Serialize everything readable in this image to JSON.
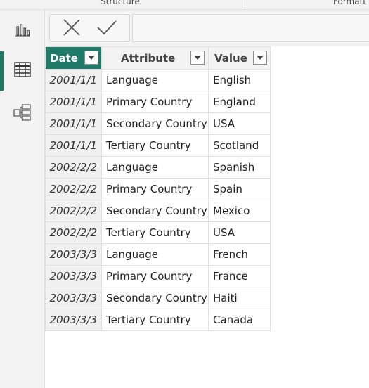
{
  "ribbon": {
    "left_group": "Structure",
    "right_group": "Formatt"
  },
  "nav": [
    {
      "icon": "report-view-icon",
      "active": false
    },
    {
      "icon": "data-view-icon",
      "active": true
    },
    {
      "icon": "model-view-icon",
      "active": false
    }
  ],
  "formula_bar": {
    "cancel_icon": "close-icon",
    "commit_icon": "check-icon",
    "value": ""
  },
  "table": {
    "columns": [
      {
        "label": "Date"
      },
      {
        "label": "Attribute"
      },
      {
        "label": "Value"
      }
    ],
    "rows": [
      {
        "date": "2001/1/1",
        "attribute": "Language",
        "value": "English"
      },
      {
        "date": "2001/1/1",
        "attribute": "Primary Country",
        "value": "England"
      },
      {
        "date": "2001/1/1",
        "attribute": "Secondary Country",
        "value": "USA"
      },
      {
        "date": "2001/1/1",
        "attribute": "Tertiary Country",
        "value": "Scotland"
      },
      {
        "date": "2002/2/2",
        "attribute": "Language",
        "value": "Spanish"
      },
      {
        "date": "2002/2/2",
        "attribute": "Primary Country",
        "value": "Spain"
      },
      {
        "date": "2002/2/2",
        "attribute": "Secondary Country",
        "value": "Mexico"
      },
      {
        "date": "2002/2/2",
        "attribute": "Tertiary Country",
        "value": "USA"
      },
      {
        "date": "2003/3/3",
        "attribute": "Language",
        "value": "French"
      },
      {
        "date": "2003/3/3",
        "attribute": "Primary Country",
        "value": "France"
      },
      {
        "date": "2003/3/3",
        "attribute": "Secondary Country",
        "value": "Haiti"
      },
      {
        "date": "2003/3/3",
        "attribute": "Tertiary Country",
        "value": "Canada"
      }
    ]
  },
  "colors": {
    "accent": "#1f7a6a",
    "header_bg": "#f3f3f3",
    "date_cell_bg": "#f0f0f0"
  }
}
